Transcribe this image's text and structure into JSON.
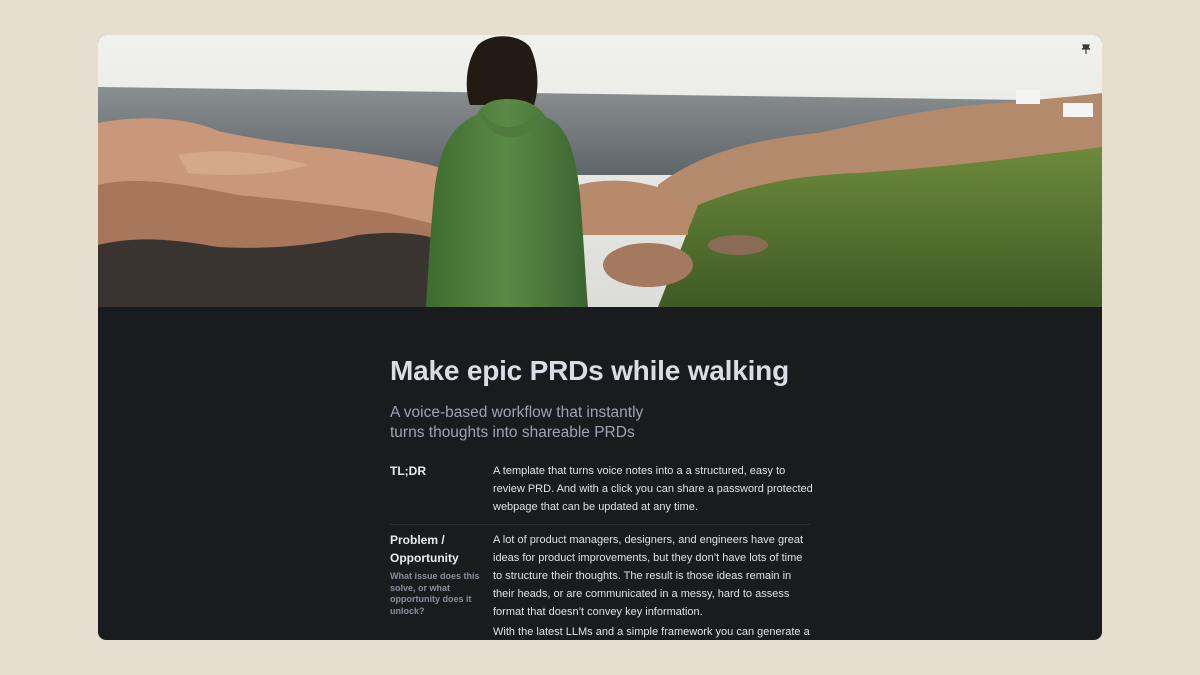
{
  "doc": {
    "title": "Make epic PRDs while walking",
    "subtitle": "A voice-based workflow that instantly turns thoughts into shareable PRDs"
  },
  "sections": [
    {
      "label": "TL;DR",
      "hint": "",
      "paragraphs": [
        "A template that turns voice notes into a a structured, easy to review PRD. And with a click you can share a password protected webpage that can be updated at any time."
      ]
    },
    {
      "label": "Problem / Opportunity",
      "hint": "What issue does this solve, or what opportunity does it unlock?",
      "paragraphs": [
        "A lot of product managers, designers, and engineers have great ideas for product improvements, but they don’t have lots of time to structure their thoughts. The result is those ideas remain in their heads, or are communicated in a messy, hard to assess format that doesn’t convey key information.",
        "With the latest LLMs and a simple framework you can generate a"
      ]
    }
  ],
  "icons": {
    "pin": "pin-icon"
  },
  "colors": {
    "background": "#e6dfcf",
    "surface": "#1a1b1f",
    "title": "#dcdce6",
    "subtitle": "#a0a2b4"
  }
}
